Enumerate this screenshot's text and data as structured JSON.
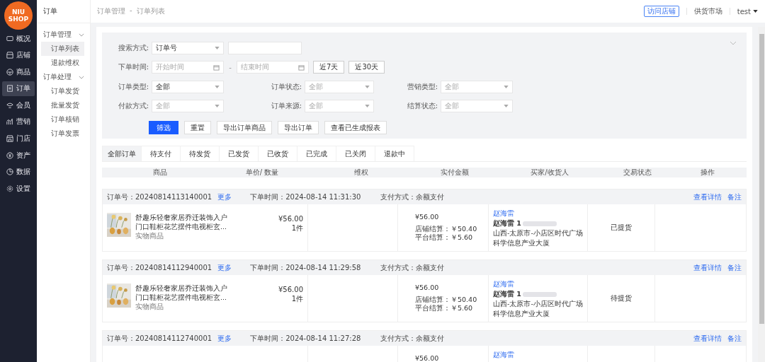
{
  "logo": {
    "line1": "NIU",
    "line2": "SHOP"
  },
  "main_nav": [
    {
      "label": "概况",
      "selected": false
    },
    {
      "label": "店铺",
      "selected": false
    },
    {
      "label": "商品",
      "selected": false
    },
    {
      "label": "订单",
      "selected": true
    },
    {
      "label": "会员",
      "selected": false
    },
    {
      "label": "营销",
      "selected": false
    },
    {
      "label": "门店",
      "selected": false
    },
    {
      "label": "资产",
      "selected": false
    },
    {
      "label": "数据",
      "selected": false
    },
    {
      "label": "设置",
      "selected": false
    }
  ],
  "sub_nav": {
    "title": "订单",
    "groups": [
      {
        "label": "订单管理",
        "expanded": true,
        "items": [
          {
            "label": "订单列表",
            "selected": true
          },
          {
            "label": "退款维权",
            "selected": false
          }
        ]
      },
      {
        "label": "订单处理",
        "expanded": true,
        "items": [
          {
            "label": "订单发货",
            "selected": false
          },
          {
            "label": "批量发货",
            "selected": false
          },
          {
            "label": "订单核销",
            "selected": false
          },
          {
            "label": "订单发票",
            "selected": false
          }
        ]
      }
    ]
  },
  "breadcrumb": [
    "订单管理",
    "-",
    "订单列表"
  ],
  "header": {
    "visit_store": "访问店铺",
    "supply_market": "供货市场",
    "user": "test"
  },
  "filters": {
    "search_label": "搜索方式:",
    "search_type": "订单号",
    "time_label": "下单时间:",
    "start_placeholder": "开始时间",
    "separator": "-",
    "end_placeholder": "结束时间",
    "quick": [
      "近7天",
      "近30天"
    ],
    "selects": [
      {
        "label": "订单类型:",
        "value": "全部"
      },
      {
        "label": "订单状态:",
        "placeholder": "全部"
      },
      {
        "label": "营销类型:",
        "placeholder": "全部"
      },
      {
        "label": "付款方式:",
        "placeholder": "全部"
      },
      {
        "label": "订单来源:",
        "placeholder": "全部"
      },
      {
        "label": "结算状态:",
        "placeholder": "全部"
      }
    ],
    "buttons": [
      {
        "label": "筛选",
        "kind": "primary"
      },
      {
        "label": "重置",
        "kind": "plain"
      },
      {
        "label": "导出订单商品",
        "kind": "plain"
      },
      {
        "label": "导出订单",
        "kind": "plain"
      },
      {
        "label": "查看已生成报表",
        "kind": "plain"
      }
    ]
  },
  "tabs": [
    {
      "label": "全部订单",
      "selected": true
    },
    {
      "label": "待支付",
      "selected": false
    },
    {
      "label": "待发货",
      "selected": false
    },
    {
      "label": "已发货",
      "selected": false
    },
    {
      "label": "已收货",
      "selected": false
    },
    {
      "label": "已完成",
      "selected": false
    },
    {
      "label": "已关闭",
      "selected": false
    },
    {
      "label": "退款中",
      "selected": false
    }
  ],
  "table": {
    "columns": [
      "商品",
      "单价/ 数量",
      "维权",
      "实付金额",
      "买家/收货人",
      "交易状态",
      "操作"
    ],
    "orders": [
      {
        "order_no": "订单号：20240814113140001",
        "more": "更多",
        "time": "下单时间：2024-08-14 11:31:30",
        "pay": "支付方式：余额支付",
        "actions": [
          "查看详情",
          "备注"
        ],
        "item": {
          "title1": "舒趣乐轻奢家居乔迁装饰入户",
          "title2": "门口鞋柜花艺摆件电视柜玄...",
          "type": "实物商品",
          "price": "¥56.00",
          "qty": "1件",
          "paid": "¥56.00",
          "store_settle": "店铺结算：￥50.40",
          "platform_settle": "平台结算：￥5.60",
          "buyer_link": "赵海雷",
          "buyer": "赵海雷 1",
          "address": "山西-太原市-小店区时代广场科学信息产业大厦",
          "status": "已提货"
        }
      },
      {
        "order_no": "订单号：20240814112940001",
        "more": "更多",
        "time": "下单时间：2024-08-14 11:29:58",
        "pay": "支付方式：余额支付",
        "actions": [
          "查看详情",
          "备注"
        ],
        "item": {
          "title1": "舒趣乐轻奢家居乔迁装饰入户",
          "title2": "门口鞋柜花艺摆件电视柜玄...",
          "type": "实物商品",
          "price": "¥56.00",
          "qty": "1件",
          "paid": "¥56.00",
          "store_settle": "店铺结算：￥50.40",
          "platform_settle": "平台结算：￥5.60",
          "buyer_link": "赵海雷",
          "buyer": "赵海雷 1",
          "address": "山西-太原市-小店区时代广场科学信息产业大厦",
          "status": "待提货"
        }
      },
      {
        "order_no": "订单号：20240814112740001",
        "more": "更多",
        "time": "下单时间：2024-08-14 11:27:28",
        "pay": "支付方式：余额支付",
        "actions": [
          "查看详情",
          "备注"
        ],
        "item": {
          "paid": "¥56.00",
          "buyer_link": "赵海雷"
        }
      }
    ]
  }
}
